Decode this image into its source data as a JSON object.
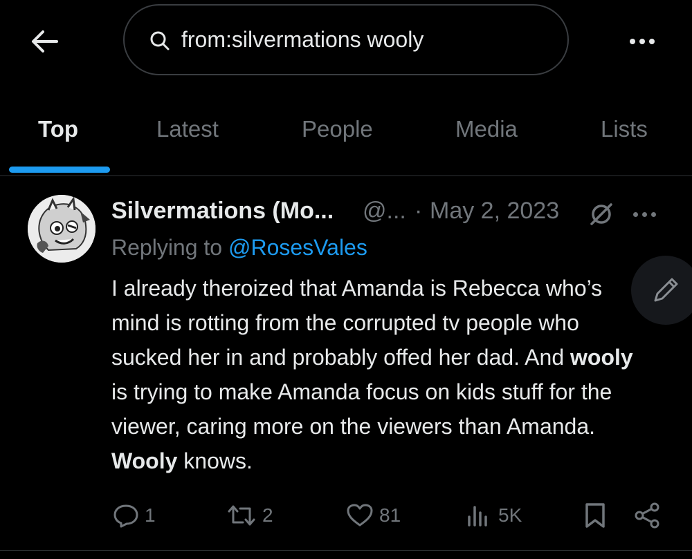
{
  "search": {
    "query": "from:silvermations wooly"
  },
  "tabs": [
    {
      "label": "Top",
      "active": true
    },
    {
      "label": "Latest",
      "active": false
    },
    {
      "label": "People",
      "active": false
    },
    {
      "label": "Media",
      "active": false
    },
    {
      "label": "Lists",
      "active": false
    }
  ],
  "tweet": {
    "display_name": "Silvermations (Mo...",
    "handle": "@...",
    "separator": "·",
    "date": "May 2, 2023",
    "replying_prefix": "Replying to ",
    "replying_to": "@RosesVales",
    "body_parts": [
      {
        "text": "I already theroized that Amanda is Rebecca who’s mind is rotting from the corrupted tv people who sucked her in and probably offed her dad. And ",
        "bold": false
      },
      {
        "text": "wooly",
        "bold": true
      },
      {
        "text": " is trying to make Amanda focus on kids stuff for the viewer, caring more on the viewers than Amanda. ",
        "bold": false
      },
      {
        "text": "Wooly",
        "bold": true
      },
      {
        "text": " knows.",
        "bold": false
      }
    ],
    "stats": {
      "replies": "1",
      "reposts": "2",
      "likes": "81",
      "views": "5K"
    }
  },
  "icons": {
    "back": "arrow-left-icon",
    "search": "search-icon",
    "more": "more-horizontal-icon",
    "grok": "grok-icon",
    "reply": "reply-icon",
    "repost": "repost-icon",
    "like": "heart-icon",
    "views": "views-icon",
    "bookmark": "bookmark-icon",
    "share": "share-icon",
    "compose": "compose-icon"
  },
  "colors": {
    "background": "#000000",
    "text": "#e7e9ea",
    "secondary": "#71767b",
    "accent": "#1d9bf0"
  }
}
